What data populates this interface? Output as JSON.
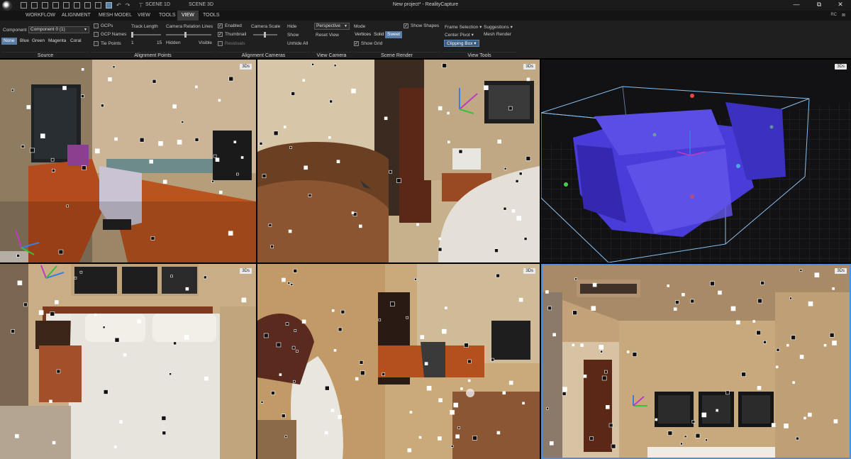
{
  "titlebar": {
    "scene_tab_1": "SCENE 1D",
    "scene_tab_2": "SCENE 3D",
    "window_title": "New project* - RealityCapture",
    "minimize": "—",
    "maximize": "⧉",
    "close": "✕"
  },
  "menu": {
    "items": [
      "WORKFLOW",
      "ALIGNMENT",
      "MESH MODEL",
      "VIEW",
      "TOOLS",
      "VIEW",
      "TOOLS"
    ],
    "active_index": 5,
    "right_label": "RC"
  },
  "ribbon": {
    "source": {
      "component_label": "Component",
      "component_value": "Component 0 (1)",
      "colors": [
        "None",
        "Blue",
        "Green",
        "Magenta",
        "Coral"
      ],
      "active_color": "None",
      "group_label": "Source"
    },
    "alignment_points": {
      "gcps": "GCPs",
      "gcp_names": "GCP Names",
      "tie_points": "Tie Points",
      "track_length": "Track Length",
      "track_min": "1",
      "track_max": "15",
      "camera_relation_lines": "Camera Relation Lines",
      "hidden": "Hidden",
      "visible": "Visible",
      "group_label": "Alignment Points"
    },
    "alignment_cameras": {
      "enabled": "Enabled",
      "thumbnail": "Thumbnail",
      "residuals": "Residuals",
      "camera_scale": "Camera Scale",
      "hide": "Hide",
      "show": "Show",
      "unhide_all": "Unhide All",
      "group_label": "Alignment Cameras"
    },
    "view_camera": {
      "projection": "Perspective",
      "reset_view": "Reset View",
      "group_label": "View Camera"
    },
    "scene_render": {
      "mode_label": "Mode",
      "modes": [
        "Vertices",
        "Solid",
        "Sweet"
      ],
      "active_mode": "Sweet",
      "show_grid": "Show Grid",
      "show_shapes": "Show Shapes",
      "group_label": "Scene Render"
    },
    "view_tools": {
      "frame_selection": "Frame Selection",
      "suggestions": "Suggestions",
      "center_pivot": "Center Pivot",
      "mesh_render": "Mesh Render",
      "clipping_box": "Clipping Box",
      "group_label": "View Tools"
    }
  },
  "viewports": [
    {
      "badge": "3Ds"
    },
    {
      "badge": "3Ds"
    },
    {
      "badge": "3Ds"
    },
    {
      "badge": "3Ds"
    },
    {
      "badge": "3Ds"
    },
    {
      "badge": "3Ds"
    }
  ],
  "colors": {
    "accent": "#4a90e2",
    "selection_blue": "#5a7ea6",
    "model_purple": "#4a3cd8",
    "wall_tan": "#c8ad86"
  }
}
